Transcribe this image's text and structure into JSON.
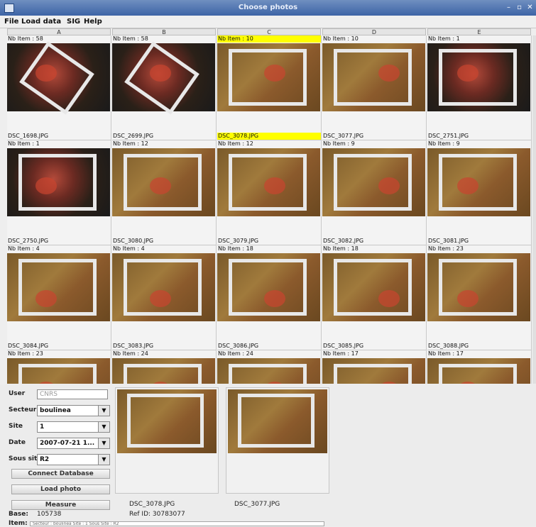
{
  "window": {
    "title": "Choose photos"
  },
  "menu": [
    "File",
    "Load data",
    "SIG",
    "Help"
  ],
  "columns": [
    "A",
    "B",
    "C",
    "D",
    "E"
  ],
  "rows": [
    [
      {
        "count": "Nb Item : 58",
        "file": "DSC_1698.JPG",
        "style": "dark-rot",
        "highlight": false
      },
      {
        "count": "Nb Item : 58",
        "file": "DSC_2699.JPG",
        "style": "dark-rot",
        "highlight": false
      },
      {
        "count": "Nb Item : 10",
        "file": "DSC_3078.JPG",
        "style": "quad",
        "highlight": true
      },
      {
        "count": "Nb Item : 10",
        "file": "DSC_3077.JPG",
        "style": "quad",
        "highlight": false
      },
      {
        "count": "Nb Item : 1",
        "file": "DSC_2751.JPG",
        "style": "dark",
        "highlight": false
      }
    ],
    [
      {
        "count": "Nb Item : 1",
        "file": "DSC_2750.JPG",
        "style": "dark",
        "highlight": false
      },
      {
        "count": "Nb Item : 12",
        "file": "DSC_3080.JPG",
        "style": "quad",
        "highlight": false
      },
      {
        "count": "Nb Item : 12",
        "file": "DSC_3079.JPG",
        "style": "quad",
        "highlight": false
      },
      {
        "count": "Nb Item : 9",
        "file": "DSC_3082.JPG",
        "style": "quad",
        "highlight": false
      },
      {
        "count": "Nb Item : 9",
        "file": "DSC_3081.JPG",
        "style": "quad",
        "highlight": false
      }
    ],
    [
      {
        "count": "Nb Item : 4",
        "file": "DSC_3084.JPG",
        "style": "quad",
        "highlight": false
      },
      {
        "count": "Nb Item : 4",
        "file": "DSC_3083.JPG",
        "style": "quad",
        "highlight": false
      },
      {
        "count": "Nb Item : 18",
        "file": "DSC_3086.JPG",
        "style": "quad",
        "highlight": false
      },
      {
        "count": "Nb Item : 18",
        "file": "DSC_3085.JPG",
        "style": "quad",
        "highlight": false
      },
      {
        "count": "Nb Item : 23",
        "file": "DSC_3088.JPG",
        "style": "quad",
        "highlight": false
      }
    ],
    [
      {
        "count": "Nb Item : 23",
        "file": "",
        "style": "quad",
        "highlight": false
      },
      {
        "count": "Nb Item : 24",
        "file": "",
        "style": "quad",
        "highlight": false
      },
      {
        "count": "Nb Item : 24",
        "file": "",
        "style": "quad",
        "highlight": false
      },
      {
        "count": "Nb Item : 17",
        "file": "",
        "style": "quad",
        "highlight": false
      },
      {
        "count": "Nb Item : 17",
        "file": "",
        "style": "quad",
        "highlight": false
      }
    ]
  ],
  "form": {
    "user_label": "User",
    "user_value": "CNRS",
    "secteur_label": "Secteur",
    "secteur_value": "boulinea",
    "site_label": "Site",
    "site_value": "1",
    "date_label": "Date",
    "date_value": "2007-07-21 1...",
    "sous_site_label": "Sous site",
    "sous_site_value": "R2",
    "connect_button": "Connect Database",
    "load_button": "Load photo",
    "measure_button": "Measure",
    "base_label": "Base:",
    "base_value": "105738",
    "item_label": "Item:"
  },
  "previews": {
    "left_file": "DSC_3078.JPG",
    "left_ref": "Ref ID: 30783077",
    "right_file": "DSC_3077.JPG"
  },
  "status": "Secteur : boulinea Site : 1 Sous Site : R2",
  "colors": {
    "highlight": "#ffff00",
    "title_bar": "#3d64a6"
  }
}
